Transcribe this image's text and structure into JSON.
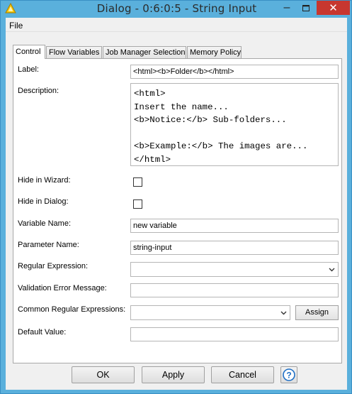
{
  "window": {
    "title": "Dialog - 0:6:0:5 - String Input",
    "icon": "knime-triangle-icon",
    "controls": {
      "minimize": "minimize-icon",
      "maximize": "maximize-icon",
      "close": "close-icon"
    }
  },
  "menu": {
    "file": "File"
  },
  "tabs": [
    {
      "label": "Control",
      "active": true
    },
    {
      "label": "Flow Variables",
      "active": false
    },
    {
      "label": "Job Manager Selection",
      "active": false
    },
    {
      "label": "Memory Policy",
      "active": false
    }
  ],
  "form": {
    "label": {
      "caption": "Label:",
      "value": "<html><b>Folder</b></html>"
    },
    "description": {
      "caption": "Description:",
      "lines": [
        "<html>",
        "Insert the name...",
        "<b>Notice:</b> Sub-folders...",
        "",
        "<b>Example:</b> The images are...",
        "</html>"
      ]
    },
    "hide_in_wizard": {
      "caption": "Hide in Wizard:",
      "checked": false
    },
    "hide_in_dialog": {
      "caption": "Hide in Dialog:",
      "checked": false
    },
    "variable_name": {
      "caption": "Variable Name:",
      "value": "new variable"
    },
    "parameter_name": {
      "caption": "Parameter Name:",
      "value": "string-input"
    },
    "regular_expression": {
      "caption": "Regular Expression:",
      "value": ""
    },
    "validation_error_message": {
      "caption": "Validation Error Message:",
      "value": ""
    },
    "common_regular_expressions": {
      "caption": "Common Regular Expressions:",
      "value": "",
      "assign_label": "Assign"
    },
    "default_value": {
      "caption": "Default Value:",
      "value": ""
    }
  },
  "buttons": {
    "ok": "OK",
    "apply": "Apply",
    "cancel": "Cancel",
    "help_icon": "help-icon"
  },
  "colors": {
    "titlebar": "#5ab0dc",
    "close_button": "#c7372f",
    "panel": "#ffffff",
    "client": "#f0f0f0"
  }
}
